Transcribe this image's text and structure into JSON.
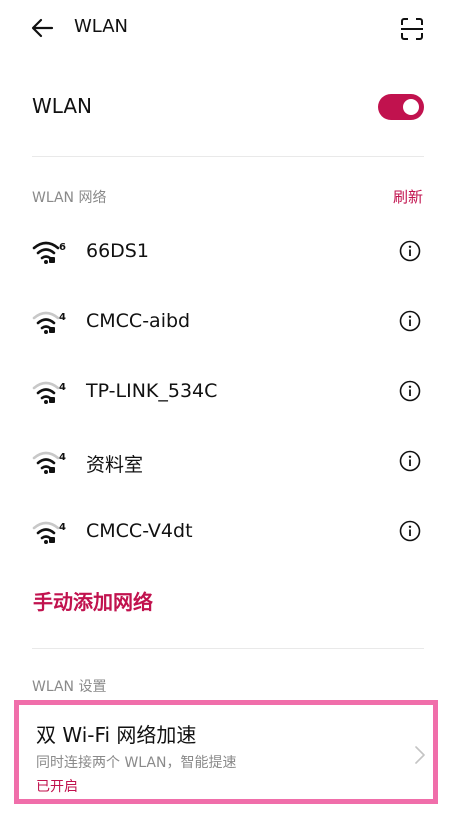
{
  "colors": {
    "accent": "#c1124e",
    "divider": "#e9e9e9",
    "muted": "#8a8a8a",
    "highlight_border": "#f06eaa"
  },
  "header": {
    "title": "WLAN",
    "back_icon": "back-arrow-icon",
    "scan_icon": "qr-scan-icon"
  },
  "master": {
    "label": "WLAN",
    "enabled": true
  },
  "networks_section": {
    "title": "WLAN 网络",
    "refresh_label": "刷新",
    "items": [
      {
        "ssid": "66DS1",
        "wifi_standard": "6",
        "signal": "full",
        "secured": true
      },
      {
        "ssid": "CMCC-aibd",
        "wifi_standard": "4",
        "signal": "medium",
        "secured": true
      },
      {
        "ssid": "TP-LINK_534C",
        "wifi_standard": "4",
        "signal": "medium",
        "secured": true
      },
      {
        "ssid": "资料室",
        "wifi_standard": "4",
        "signal": "medium",
        "secured": true
      },
      {
        "ssid": "CMCC-V4dt",
        "wifi_standard": "4",
        "signal": "medium",
        "secured": true
      }
    ],
    "add_network_label": "手动添加网络"
  },
  "settings_section": {
    "title": "WLAN 设置",
    "dual_wifi": {
      "title": "双 Wi-Fi 网络加速",
      "subtitle": "同时连接两个 WLAN，智能提速",
      "status": "已开启"
    }
  }
}
